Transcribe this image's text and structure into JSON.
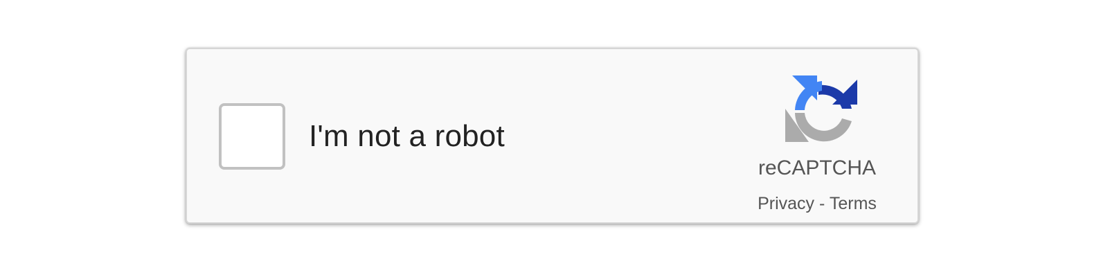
{
  "captcha": {
    "label": "I'm not a robot",
    "checked": false,
    "brand": "reCAPTCHA",
    "privacy_label": "Privacy",
    "separator": "-",
    "terms_label": "Terms",
    "logo_icon": "recaptcha-logo-icon",
    "colors": {
      "logo_blue_dark": "#1c3aa9",
      "logo_blue_light": "#4285f4",
      "logo_gray": "#ababab",
      "text": "#555555"
    }
  }
}
